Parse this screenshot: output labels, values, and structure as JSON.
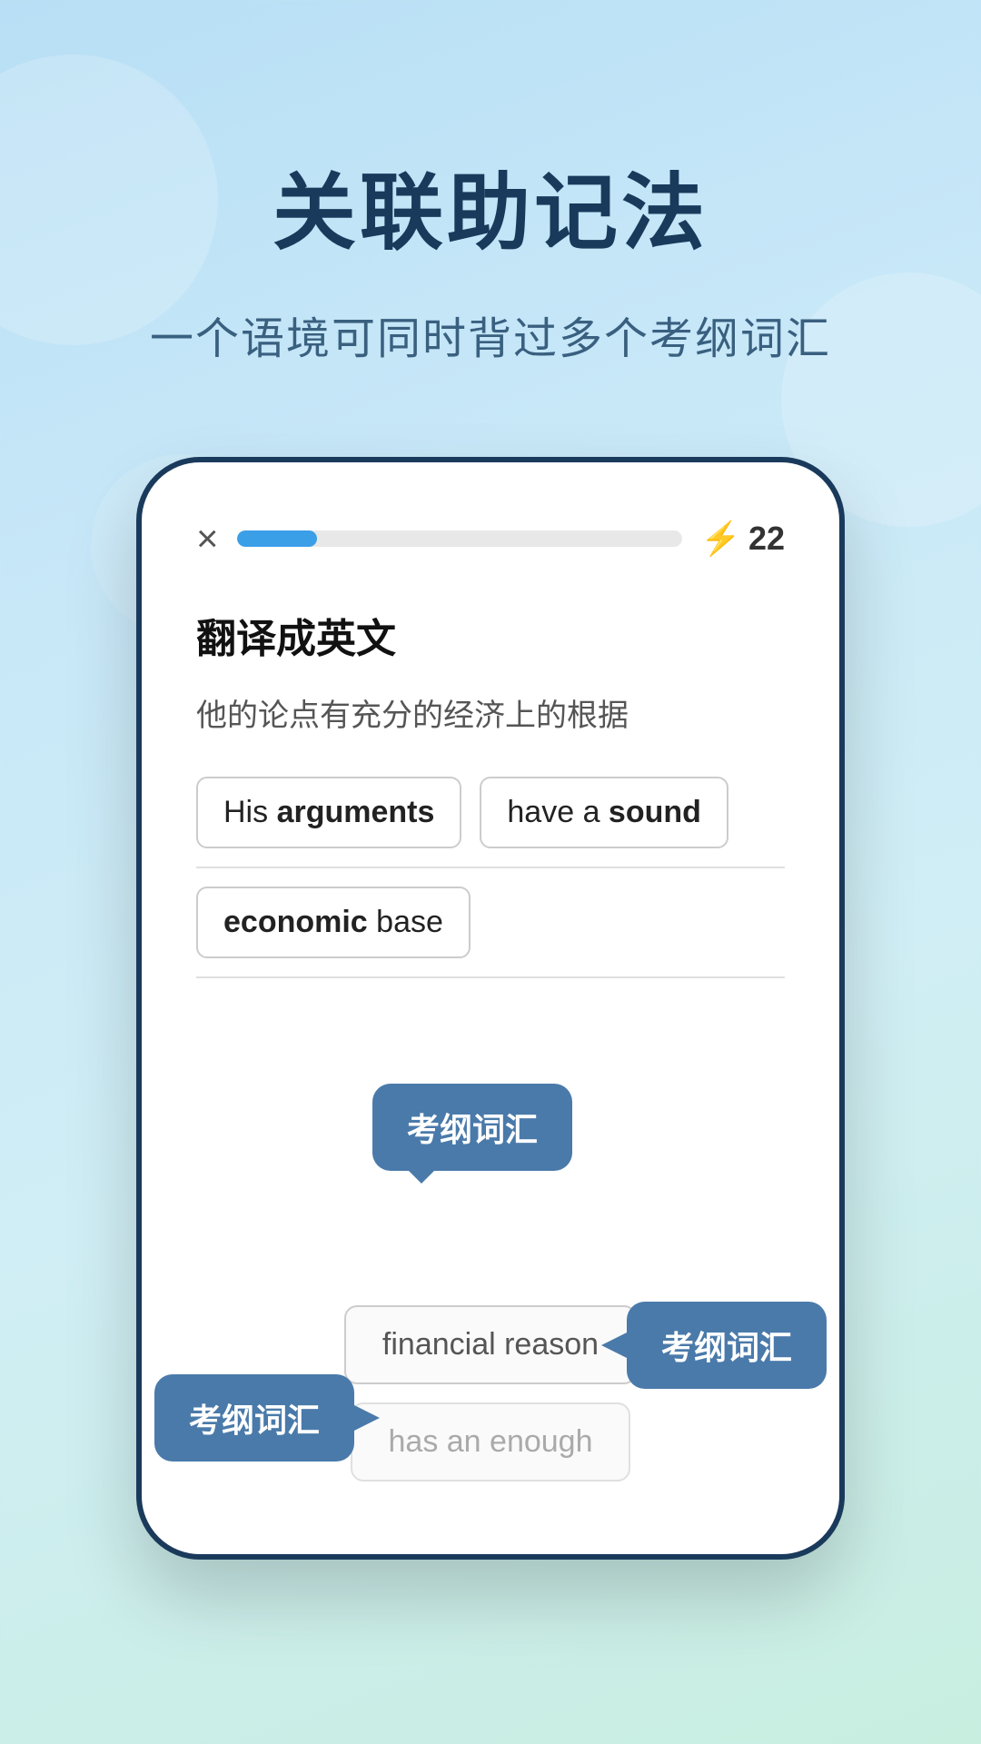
{
  "background": {
    "gradient_start": "#b8dff5",
    "gradient_end": "#c8eee0"
  },
  "header": {
    "main_title": "关联助记法",
    "subtitle": "一个语境可同时背过多个考纲词汇"
  },
  "phone": {
    "progress": {
      "close_label": "×",
      "progress_percent": 18,
      "score": 22,
      "score_label": "22"
    },
    "section": {
      "title": "翻译成英文",
      "chinese_sentence": "他的论点有充分的经济上的根据"
    },
    "answer_filled": [
      {
        "text": "His ",
        "bold": false
      },
      {
        "text": "arguments",
        "bold": true
      },
      {
        "text": " have a ",
        "bold": false
      },
      {
        "text": "sound",
        "bold": true
      }
    ],
    "answer_line2": [
      {
        "text": "economic",
        "bold": true
      },
      {
        "text": " base",
        "bold": false
      }
    ],
    "answer_options": [
      {
        "text": "financial reason",
        "muted": false
      },
      {
        "text": "has an enough",
        "muted": true
      }
    ],
    "tooltips": [
      {
        "id": "tooltip-1",
        "text": "考纲词汇",
        "position": "top"
      },
      {
        "id": "tooltip-2",
        "text": "考纲词汇",
        "position": "right"
      },
      {
        "id": "tooltip-3",
        "text": "考纲词汇",
        "position": "left"
      }
    ]
  }
}
